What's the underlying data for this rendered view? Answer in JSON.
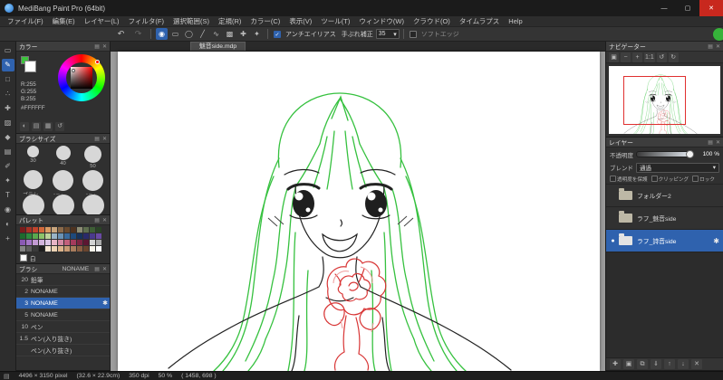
{
  "titlebar": {
    "title": "MediBang Paint Pro (64bit)",
    "controls": [
      {
        "name": "minimize",
        "glyph": "—"
      },
      {
        "name": "maximize",
        "glyph": "▢"
      },
      {
        "name": "close",
        "glyph": "✕"
      }
    ]
  },
  "menu": {
    "items": [
      "ファイル(F)",
      "編集(E)",
      "レイヤー(L)",
      "フィルタ(F)",
      "選択範囲(S)",
      "定規(R)",
      "カラー(C)",
      "表示(V)",
      "ツール(T)",
      "ウィンドウ(W)",
      "クラウド(O)",
      "タイムラプス",
      "Help"
    ]
  },
  "toolbar": {
    "undo_icon": "↶",
    "redo_icon": "↷",
    "modes": [
      {
        "name": "pen-mode-icon",
        "glyph": "◉",
        "active": true
      },
      {
        "name": "rect-mode-icon",
        "glyph": "▭",
        "active": false
      },
      {
        "name": "ellipse-mode-icon",
        "glyph": "◯",
        "active": false
      },
      {
        "name": "line-mode-icon",
        "glyph": "╱",
        "active": false
      },
      {
        "name": "curve-mode-icon",
        "glyph": "∿",
        "active": false
      },
      {
        "name": "fill-mode-icon",
        "glyph": "▩",
        "active": false
      },
      {
        "name": "snap-mode-icon",
        "glyph": "✚",
        "active": false
      },
      {
        "name": "special-mode-icon",
        "glyph": "✦",
        "active": false
      }
    ],
    "antialias_label": "アンチエイリアス",
    "antialias_check": "✓",
    "stabilizer_label": "手ぶれ補正",
    "stabilizer_value": "35",
    "stabilizer_arrow": "▾",
    "softedge_label": "ソフトエッジ",
    "status_dot_color": "#36b23a"
  },
  "toolstrip": {
    "tools": [
      {
        "name": "select-tool",
        "glyph": "▭",
        "active": false
      },
      {
        "name": "brush-tool",
        "glyph": "✎",
        "active": true
      },
      {
        "name": "eraser-tool",
        "glyph": "□",
        "active": false
      },
      {
        "name": "dot-tool",
        "glyph": "∴",
        "active": false
      },
      {
        "name": "move-tool",
        "glyph": "✚",
        "active": false
      },
      {
        "name": "fill-tool",
        "glyph": "▨",
        "active": false
      },
      {
        "name": "bucket-tool",
        "glyph": "◆",
        "active": false
      },
      {
        "name": "gradient-tool",
        "glyph": "▤",
        "active": false
      },
      {
        "name": "select-pen-tool",
        "glyph": "✐",
        "active": false
      },
      {
        "name": "magic-wand-tool",
        "glyph": "✦",
        "active": false
      },
      {
        "name": "text-tool",
        "glyph": "T",
        "active": false
      },
      {
        "name": "eyedropper-tool",
        "glyph": "◉",
        "active": false
      },
      {
        "name": "hand-tool",
        "glyph": "◐",
        "active": false
      },
      {
        "name": "zoom-tool",
        "glyph": "+",
        "active": false
      }
    ]
  },
  "panel_icons": [
    {
      "name": "panel-menu-icon",
      "glyph": "▤"
    },
    {
      "name": "panel-close-icon",
      "glyph": "✕"
    }
  ],
  "color_panel": {
    "title": "カラー",
    "r_label": "R:255",
    "g_label": "G:255",
    "b_label": "B:255",
    "hex": "#FFFFFF",
    "current_color": "#ffffff",
    "secondary_color": "#3cc43c",
    "icons": [
      {
        "name": "wheel-view-icon",
        "glyph": "◐"
      },
      {
        "name": "slider-view-icon",
        "glyph": "▤"
      },
      {
        "name": "grid-view-icon",
        "glyph": "▦"
      },
      {
        "name": "history-icon",
        "glyph": "↺"
      }
    ]
  },
  "brush_size_panel": {
    "title": "ブラシサイズ",
    "items": [
      {
        "d": 13,
        "label": "30"
      },
      {
        "d": 16,
        "label": "40"
      },
      {
        "d": 19,
        "label": "50"
      },
      {
        "d": 21,
        "label": "ブラシ…"
      },
      {
        "d": 23,
        "label": "ブラシコ…"
      },
      {
        "d": 23,
        "label": "ブラシ…"
      },
      {
        "d": 24,
        "label": ""
      },
      {
        "d": 24,
        "label": ""
      },
      {
        "d": 24,
        "label": ""
      }
    ]
  },
  "palette_panel": {
    "title": "パレット",
    "white_label": "白",
    "colors": [
      "#7a1c1c",
      "#a83226",
      "#c1442c",
      "#d2693a",
      "#d99a62",
      "#caa67e",
      "#8a6a4a",
      "#6a4a2e",
      "#4e3320",
      "#8c8c74",
      "#5e6e4e",
      "#3e5e36",
      "#2a4426",
      "#1e6a2e",
      "#2e8a3e",
      "#5aa84e",
      "#8cc26a",
      "#bcd29a",
      "#9ab4c6",
      "#6a92b4",
      "#3a6a9c",
      "#1e4a7c",
      "#16325c",
      "#2a2a6a",
      "#4a3a8c",
      "#6a4aa4",
      "#8a5ab4",
      "#a476c6",
      "#c29ad2",
      "#d2b4dc",
      "#dcc6e6",
      "#e6b4c6",
      "#d28aa4",
      "#c2607c",
      "#a43a5c",
      "#7c2442",
      "#5c1632",
      "#d2d2d2",
      "#ababab",
      "#848484",
      "#5e5e5e",
      "#3a3a3a",
      "#1e1e1e",
      "#f5e6d2",
      "#ecd2b4",
      "#dcb48c",
      "#c89a74",
      "#a87c5c",
      "#8a5e42",
      "#6a452e",
      "#f7f3ea",
      "#ffffff"
    ]
  },
  "brush_panel": {
    "title": "ブラシ",
    "subtitle": "NONAME",
    "gear_glyph": "✱",
    "brushes": [
      {
        "size": "20",
        "name": "鉛筆",
        "selected": false
      },
      {
        "size": "2",
        "name": "NONAME",
        "selected": false
      },
      {
        "size": "3",
        "name": "NONAME",
        "selected": true
      },
      {
        "size": "5",
        "name": "NONAME",
        "selected": false
      },
      {
        "size": "10",
        "name": "ペン",
        "selected": false
      },
      {
        "size": "1.5",
        "name": "ペン(入り抜き)",
        "selected": false
      },
      {
        "size": "",
        "name": "ペン(入り抜き)",
        "selected": false
      }
    ]
  },
  "canvas": {
    "tab_title": "魅音side.mdp"
  },
  "navigator": {
    "title": "ナビゲーター",
    "icons": [
      {
        "name": "fit-icon",
        "glyph": "▣"
      },
      {
        "name": "zoom-out-icon",
        "glyph": "−"
      },
      {
        "name": "zoom-in-icon",
        "glyph": "+"
      },
      {
        "name": "actual-size-icon",
        "glyph": "1:1"
      },
      {
        "name": "rotate-left-icon",
        "glyph": "↺"
      },
      {
        "name": "rotate-right-icon",
        "glyph": "↻"
      }
    ]
  },
  "layer_panel": {
    "title": "レイヤー",
    "opacity_label": "不透明度",
    "opacity_value": "100 %",
    "blend_label": "ブレンド",
    "blend_value": "通過",
    "blend_arrow": "▾",
    "options": [
      {
        "name": "protect-alpha",
        "label": "透明度を保護"
      },
      {
        "name": "clipping",
        "label": "クリッピング"
      },
      {
        "name": "lock",
        "label": "ロック"
      }
    ],
    "current_marker": "●",
    "gear_glyph": "✱",
    "layers": [
      {
        "name": "フォルダー2",
        "selected": false,
        "current": false
      },
      {
        "name": "ラフ_魅音side",
        "selected": false,
        "current": false
      },
      {
        "name": "ラフ_詩音side",
        "selected": true,
        "current": true
      }
    ],
    "bottom_icons": [
      {
        "name": "new-layer-icon",
        "glyph": "✚"
      },
      {
        "name": "new-folder-icon",
        "glyph": "▣"
      },
      {
        "name": "duplicate-layer-icon",
        "glyph": "⧉"
      },
      {
        "name": "merge-down-icon",
        "glyph": "⇓"
      },
      {
        "name": "layer-up-icon",
        "glyph": "↑"
      },
      {
        "name": "layer-down-icon",
        "glyph": "↓"
      },
      {
        "name": "delete-layer-icon",
        "glyph": "✕"
      }
    ]
  },
  "statusbar": {
    "doc_icon": "▤",
    "size": "4496 × 3150 pixel",
    "dimensions_cm": "(32.6 × 22.9cm)",
    "dpi": "350 dpi",
    "zoom": "50 %",
    "cursor": "( 1458, 698 )"
  },
  "artwork": {
    "hair_color": "#36c13f",
    "line_color": "#222222",
    "flower_color": "#d83535",
    "flower_light_color": "#ef9a9a"
  }
}
